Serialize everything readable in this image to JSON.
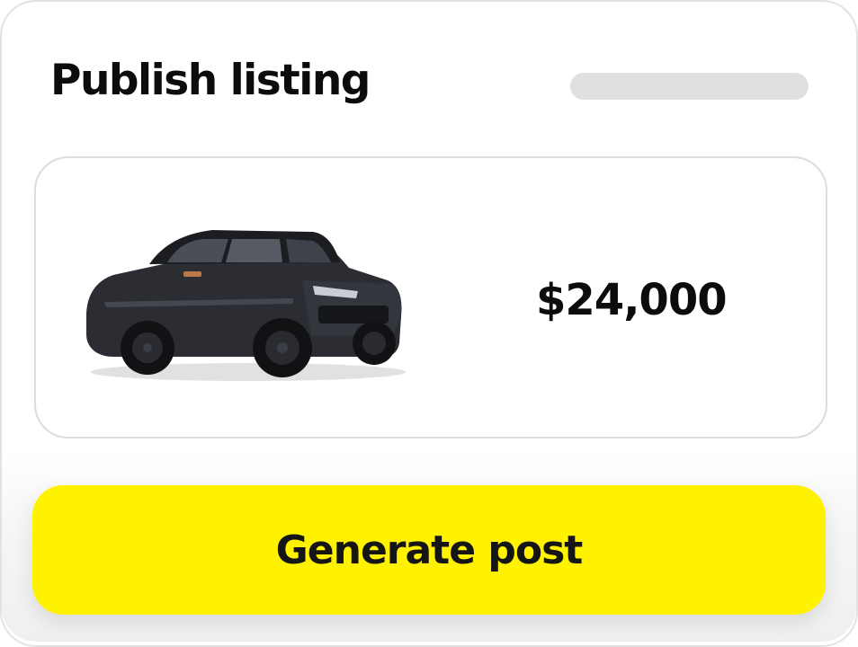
{
  "header": {
    "title": "Publish listing"
  },
  "listing": {
    "image": "car-photo",
    "price": "$24,000"
  },
  "actions": {
    "generate_label": "Generate post"
  },
  "colors": {
    "accent": "#fff200",
    "text": "#0c0c0c",
    "border": "#dcdcdc",
    "skeleton": "#e0e0e0"
  }
}
